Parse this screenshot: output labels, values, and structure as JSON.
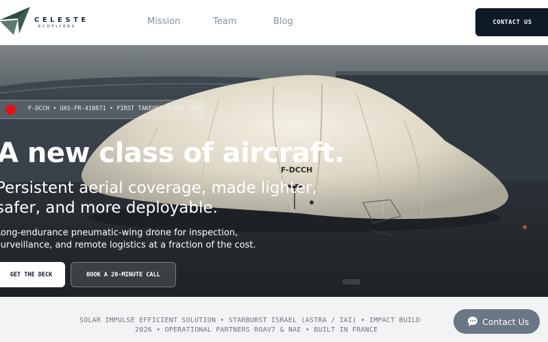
{
  "header": {
    "brand_name": "CELESTE",
    "brand_tagline": "ECOFLYERS",
    "nav": [
      "Mission",
      "Team",
      "Blog"
    ],
    "contact_label": "CONTACT US"
  },
  "hero": {
    "badge_text": "F-DCCH • UAS-FR-410871 • FIRST TAKEOFF 7 MAY 2026",
    "badge_dot_color": "#e11414",
    "title": "A new class of aircraft.",
    "subtitle": "Persistent aerial coverage, made lighter, safer, and more deployable.",
    "description": "Long-endurance pneumatic-wing drone for inspection, surveillance, and remote logistics at a fraction of the cost.",
    "primary_cta": "GET THE DECK",
    "secondary_cta": "BOOK A 20-MINUTE CALL",
    "aircraft_marking": "F-DCCH"
  },
  "partners": {
    "line1": "SOLAR IMPULSE EFFICIENT SOLUTION   •   STARBURST ISRAEL (ASTRA / IAI)   •   IMPACT BUILD",
    "line2": "2026   •   OPERATIONAL PARTNERS ROAV7 & NAE   •   BUILT IN FRANCE"
  },
  "chat": {
    "label": "Contact Us",
    "icon": "chat-bubble-icon"
  },
  "colors": {
    "primary_dark": "#0f1a27",
    "nav_text": "#7f8ea3",
    "strip_bg": "#f1f3f5",
    "chat_bg": "#6a7785"
  }
}
